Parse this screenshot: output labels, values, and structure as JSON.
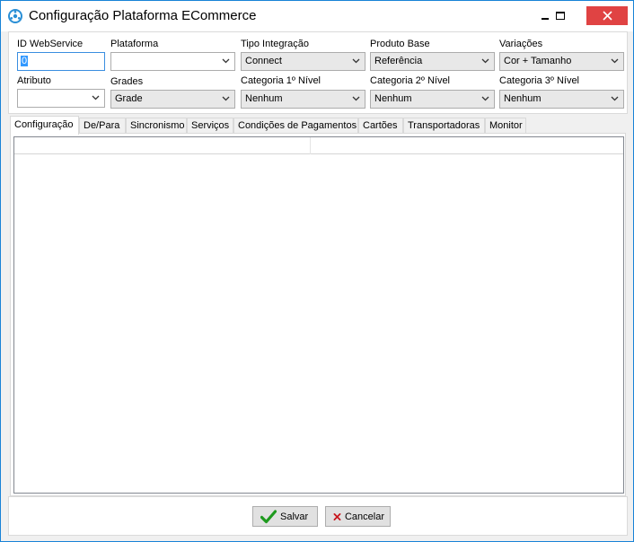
{
  "window": {
    "title": "Configuração Plataforma ECommerce"
  },
  "fields": {
    "id_webservice": {
      "label": "ID WebService",
      "value": "0"
    },
    "plataforma": {
      "label": "Plataforma",
      "value": ""
    },
    "tipo_integracao": {
      "label": "Tipo Integração",
      "value": "Connect"
    },
    "produto_base": {
      "label": "Produto Base",
      "value": "Referência"
    },
    "variacoes": {
      "label": "Variações",
      "value": "Cor + Tamanho"
    },
    "atributo": {
      "label": "Atributo",
      "value": ""
    },
    "grades": {
      "label": "Grades",
      "value": "Grade"
    },
    "categoria1": {
      "label": "Categoria 1º Nível",
      "value": "Nenhum"
    },
    "categoria2": {
      "label": "Categoria 2º Nível",
      "value": "Nenhum"
    },
    "categoria3": {
      "label": "Categoria 3º Nível",
      "value": "Nenhum"
    }
  },
  "tabs": [
    {
      "label": "Configuração",
      "active": true
    },
    {
      "label": "De/Para"
    },
    {
      "label": "Sincronismo"
    },
    {
      "label": "Serviços"
    },
    {
      "label": "Condições de Pagamentos"
    },
    {
      "label": "Cartões"
    },
    {
      "label": "Transportadoras"
    },
    {
      "label": "Monitor"
    }
  ],
  "buttons": {
    "save": "Salvar",
    "cancel": "Cancelar"
  },
  "colors": {
    "accent": "#1883d7",
    "close_button": "#e04343",
    "selection": "#3399ff",
    "save_icon": "#1e9a1e",
    "cancel_icon": "#c8161d"
  },
  "icons": {
    "app": "gear-cog-icon",
    "save": "checkmark-icon",
    "cancel": "x-mark-icon"
  }
}
